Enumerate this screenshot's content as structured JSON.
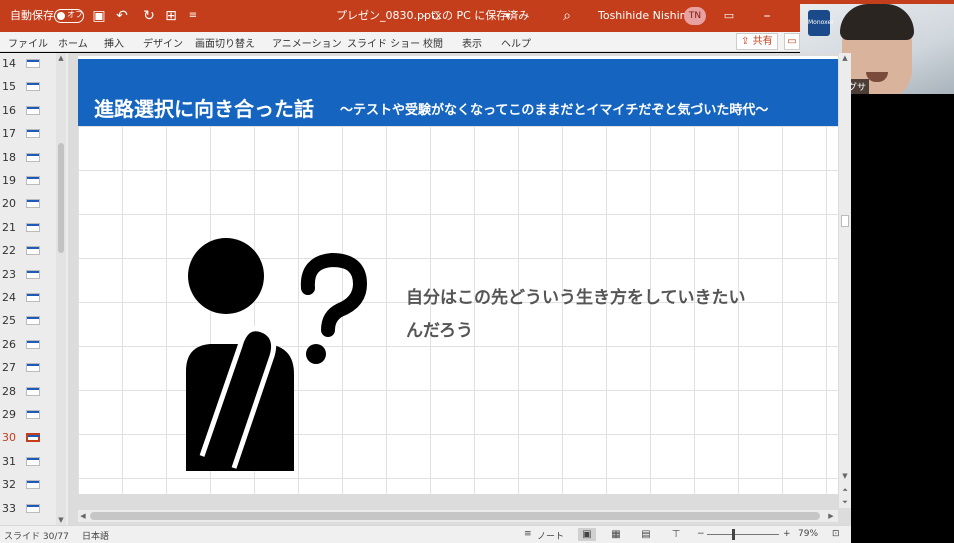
{
  "titlebar": {
    "autosave_label": "自動保存",
    "autosave_state": "オフ",
    "filename": "プレゼン_0830.pptx",
    "save_status": "この PC に保存済み",
    "separator": "-",
    "dropdown": "▾",
    "user_name": "Toshihide Nishima",
    "user_initials": "TN",
    "icons": [
      "save-icon",
      "undo-icon",
      "redo-icon",
      "present-icon",
      "customize-icon",
      "search-icon",
      "ribbon-display-icon",
      "minimize-icon"
    ]
  },
  "ribbon": {
    "tabs": [
      "ファイル",
      "ホーム",
      "挿入",
      "デザイン",
      "画面切り替え",
      "アニメーション",
      "スライド ショー",
      "校閲",
      "表示",
      "ヘルプ"
    ],
    "share_label": "共有"
  },
  "webcam": {
    "name": "二嶋@モノグサ",
    "logo_text": "Monoxer"
  },
  "thumbnails": {
    "numbers": [
      "14",
      "15",
      "16",
      "17",
      "18",
      "19",
      "20",
      "21",
      "22",
      "23",
      "24",
      "25",
      "26",
      "27",
      "28",
      "29",
      "30",
      "31",
      "32",
      "33"
    ],
    "active": "30"
  },
  "slide": {
    "title": "進路選択に向き合った話",
    "subtitle": "～テストや受験がなくなってこのままだとイマイチだぞと気づいた時代～",
    "body_line1": "自分はこの先どういう生き方をしていきたい",
    "body_line2": "んだろう",
    "header_color": "#1565c0"
  },
  "statusbar": {
    "slide_info": "スライド 30/77",
    "language": "日本語",
    "notes_label": "ノート",
    "zoom_minus": "−",
    "zoom_plus": "+",
    "zoom_level": "79%"
  },
  "colors": {
    "accent": "#c43e1c",
    "slide_header": "#1565c0"
  }
}
